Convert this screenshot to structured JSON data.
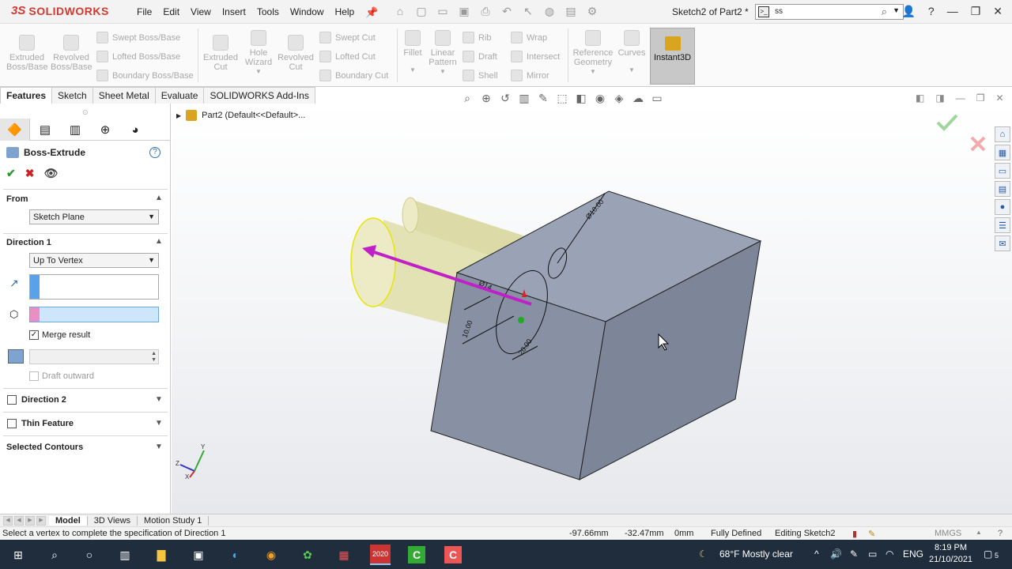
{
  "app": {
    "logo_ds": "3S",
    "logo_name": "SOLIDWORKS",
    "doc_title": "Sketch2 of Part2 *",
    "search_value": "ss"
  },
  "menu": [
    "File",
    "Edit",
    "View",
    "Insert",
    "Tools",
    "Window",
    "Help"
  ],
  "ribbon": {
    "extruded_boss": "Extruded Boss/Base",
    "revolved_boss": "Revolved Boss/Base",
    "swept_boss": "Swept Boss/Base",
    "lofted_boss": "Lofted Boss/Base",
    "boundary_boss": "Boundary Boss/Base",
    "extruded_cut": "Extruded Cut",
    "hole_wizard": "Hole Wizard",
    "revolved_cut": "Revolved Cut",
    "swept_cut": "Swept Cut",
    "lofted_cut": "Lofted Cut",
    "boundary_cut": "Boundary Cut",
    "fillet": "Fillet",
    "linear_pattern": "Linear Pattern",
    "rib": "Rib",
    "draft": "Draft",
    "shell": "Shell",
    "wrap": "Wrap",
    "intersect": "Intersect",
    "mirror": "Mirror",
    "reference_geometry": "Reference Geometry",
    "curves": "Curves",
    "instant3d": "Instant3D"
  },
  "tabs": [
    "Features",
    "Sketch",
    "Sheet Metal",
    "Evaluate",
    "SOLIDWORKS Add-Ins"
  ],
  "tree": {
    "root": "Part2  (Default<<Default>..."
  },
  "pm": {
    "title": "Boss-Extrude",
    "from_label": "From",
    "from_value": "Sketch Plane",
    "dir1_label": "Direction 1",
    "dir1_value": "Up To Vertex",
    "merge_result": "Merge result",
    "draft_outward": "Draft outward",
    "direction2": "Direction 2",
    "thin_feature": "Thin Feature",
    "selected_contours": "Selected Contours"
  },
  "annotations": {
    "dim1": "Ø14",
    "dim2": "10.00",
    "dim3": "20.00",
    "dim4": "Ø10.00"
  },
  "triad": {
    "x": "X",
    "y": "Y",
    "z": "Z"
  },
  "bottom_tabs": [
    "Model",
    "3D Views",
    "Motion Study 1"
  ],
  "status": {
    "message": "Select a vertex to complete the specification of Direction 1",
    "x": "-97.66mm",
    "y": "-32.47mm",
    "z": "0mm",
    "state": "Fully Defined",
    "editing": "Editing Sketch2",
    "units": "MMGS"
  },
  "taskbar": {
    "weather": "68°F  Mostly clear",
    "lang": "ENG",
    "time": "8:19 PM",
    "date": "21/10/2021",
    "sw_badge": "2020",
    "notif_count": "5"
  },
  "colors": {
    "accent": "#d23a2f",
    "selection_blue": "#5aa2e8",
    "selection_pink": "#e98fc3",
    "arrow": "#c020c8",
    "cylinder": "#ecebc5",
    "box": "#8e97ab"
  }
}
